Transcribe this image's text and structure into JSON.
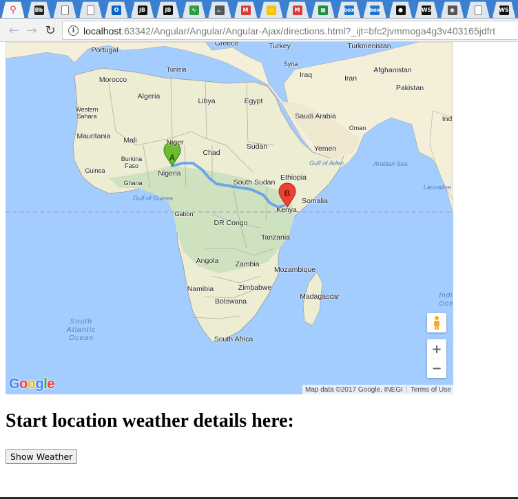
{
  "browser": {
    "tabs": [
      {
        "icon": "search-icon",
        "color": "#d93a3a",
        "glyph": "⚲",
        "active": true
      },
      {
        "icon": "blackboard-icon",
        "color": "#222222",
        "glyph": "Bb"
      },
      {
        "icon": "document-icon",
        "color": "#ffffff",
        "glyph": ""
      },
      {
        "icon": "document-icon",
        "color": "#ffffff",
        "glyph": ""
      },
      {
        "icon": "outlook-icon",
        "color": "#0a64c8",
        "glyph": "O"
      },
      {
        "icon": "jetbrains-icon",
        "color": "#111111",
        "glyph": "JB"
      },
      {
        "icon": "jetbrains-icon",
        "color": "#111111",
        "glyph": "JB"
      },
      {
        "icon": "chart-icon",
        "color": "#2e9e44",
        "glyph": "∿"
      },
      {
        "icon": "speaker-icon",
        "color": "#555555",
        "glyph": "🔈"
      },
      {
        "icon": "gmail-icon",
        "color": "#d93a3a",
        "glyph": "M"
      },
      {
        "icon": "keep-icon",
        "color": "#f4c20d",
        "glyph": "▭"
      },
      {
        "icon": "gmail-icon",
        "color": "#d93a3a",
        "glyph": "M"
      },
      {
        "icon": "sheets-icon",
        "color": "#1e8e3e",
        "glyph": "▦"
      },
      {
        "icon": "box-icon",
        "color": "#1b75d0",
        "glyph": "box"
      },
      {
        "icon": "box-icon",
        "color": "#1b75d0",
        "glyph": "box"
      },
      {
        "icon": "github-icon",
        "color": "#111111",
        "glyph": "●"
      },
      {
        "icon": "webstorm-icon",
        "color": "#111111",
        "glyph": "WS"
      },
      {
        "icon": "ninja-icon",
        "color": "#555555",
        "glyph": "◉"
      },
      {
        "icon": "document-icon",
        "color": "#ffffff",
        "glyph": ""
      },
      {
        "icon": "webstorm-icon",
        "color": "#111111",
        "glyph": "WS"
      }
    ],
    "back_icon": "back-arrow-icon",
    "forward_icon": "forward-arrow-icon",
    "reload_icon": "reload-icon",
    "url_host": "localhost",
    "url_rest": ":63342/Angular/Angular/Angular-Ajax/directions.html?_ijt=bfc2jvmmoga4g3v403165jdfrt"
  },
  "map": {
    "countries": [
      {
        "name": "Portugal"
      },
      {
        "name": "Greece"
      },
      {
        "name": "Turkey"
      },
      {
        "name": "Turkmenistan"
      },
      {
        "name": "Tunisia"
      },
      {
        "name": "Syria"
      },
      {
        "name": "Morocco"
      },
      {
        "name": "Iraq"
      },
      {
        "name": "Afghanistan"
      },
      {
        "name": "Iran"
      },
      {
        "name": "Algeria"
      },
      {
        "name": "Libya"
      },
      {
        "name": "Egypt"
      },
      {
        "name": "Pakistan"
      },
      {
        "name": "Western\nSahara"
      },
      {
        "name": "Saudi Arabia"
      },
      {
        "name": "Ind"
      },
      {
        "name": "Oman"
      },
      {
        "name": "Mauritania"
      },
      {
        "name": "Mali"
      },
      {
        "name": "Niger"
      },
      {
        "name": "Sudan"
      },
      {
        "name": "Chad"
      },
      {
        "name": "Yemen"
      },
      {
        "name": "Burkina\nFaso"
      },
      {
        "name": "Guinea"
      },
      {
        "name": "Nigeria"
      },
      {
        "name": "Ethiopia"
      },
      {
        "name": "Ghana"
      },
      {
        "name": "South Sudan"
      },
      {
        "name": "Somalia"
      },
      {
        "name": "Kenya"
      },
      {
        "name": "Gabon"
      },
      {
        "name": "DR Congo"
      },
      {
        "name": "Tanzania"
      },
      {
        "name": "Angola"
      },
      {
        "name": "Zambia"
      },
      {
        "name": "Mozambique"
      },
      {
        "name": "Namibia"
      },
      {
        "name": "Zimbabwe"
      },
      {
        "name": "Madagascar"
      },
      {
        "name": "Botswana"
      },
      {
        "name": "South Africa"
      }
    ],
    "water_labels": [
      {
        "name": "Gulf of Aden"
      },
      {
        "name": "Arabian Sea"
      },
      {
        "name": "Gulf of Guinea"
      },
      {
        "name": "Laccadive"
      },
      {
        "name": "Indi\nOce"
      }
    ],
    "ocean_label": "South\nAtlantic\nOcean",
    "marker_a": "A",
    "marker_b": "B",
    "pegman_icon": "pegman-icon",
    "zoom_in": "+",
    "zoom_out": "−",
    "logo_text": "Google",
    "attribution": "Map data ©2017 Google, INEGI",
    "terms": "Terms of Use"
  },
  "page": {
    "heading": "Start location weather details here:",
    "show_weather_button": "Show Weather"
  }
}
